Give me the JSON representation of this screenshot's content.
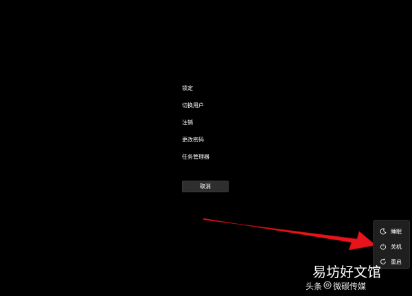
{
  "menu": {
    "items": [
      {
        "label": "锁定"
      },
      {
        "label": "切换用户"
      },
      {
        "label": "注销"
      },
      {
        "label": "更改密码"
      },
      {
        "label": "任务管理器"
      }
    ]
  },
  "cancel": {
    "label": "取消"
  },
  "power_menu": {
    "items": [
      {
        "icon": "moon-icon",
        "label": "睡眠"
      },
      {
        "icon": "power-icon",
        "label": "关机"
      },
      {
        "icon": "restart-icon",
        "label": "重启"
      }
    ]
  },
  "annotation": {
    "arrow_color": "#e8141c"
  },
  "watermark": {
    "title": "易坊好文馆",
    "source": "头条",
    "author": "微碳传媒"
  },
  "colors": {
    "background": "#000000",
    "button_bg": "#2e2e2e",
    "flyout_bg": "#1f1f1f",
    "text": "#ffffff"
  }
}
